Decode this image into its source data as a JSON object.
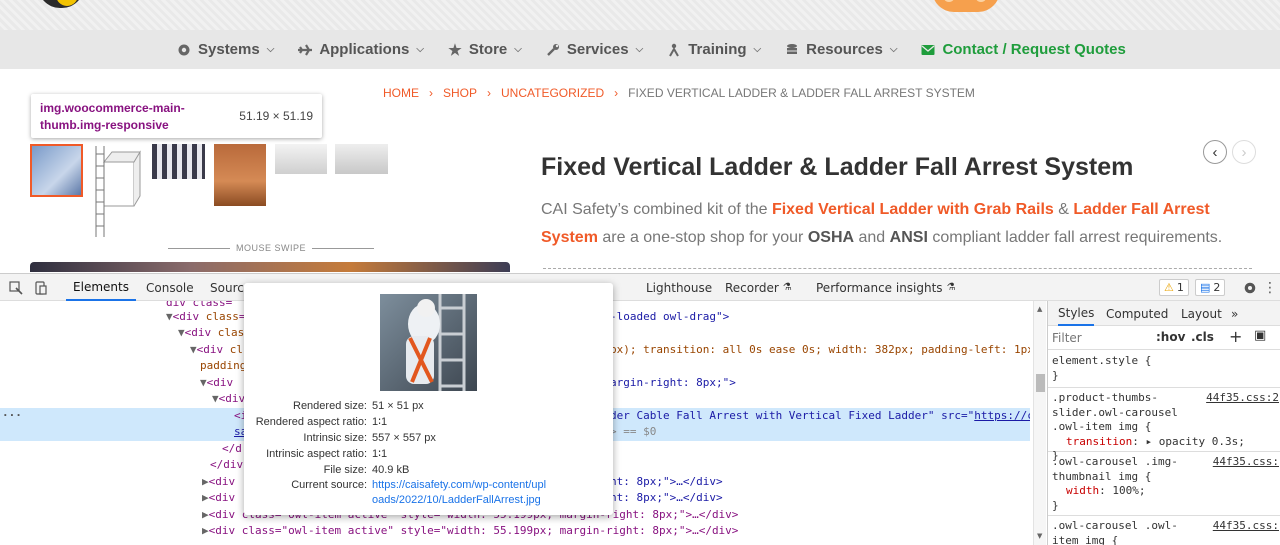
{
  "site": {
    "nav": [
      {
        "label": "Systems",
        "icon": "gear-icon"
      },
      {
        "label": "Applications",
        "icon": "plane-icon"
      },
      {
        "label": "Store",
        "icon": "star-icon"
      },
      {
        "label": "Services",
        "icon": "wrench-icon"
      },
      {
        "label": "Training",
        "icon": "person-icon"
      },
      {
        "label": "Resources",
        "icon": "database-icon"
      }
    ],
    "contact_label": "Contact / Request Quotes",
    "breadcrumb": [
      "HOME",
      "SHOP",
      "UNCATEGORIZED"
    ],
    "breadcrumb_current": "FIXED VERTICAL LADDER & LADDER FALL ARREST SYSTEM",
    "tooltip": {
      "selector": "img.woocommerce-main-thumb.img-responsive",
      "size": "51.19 × 51.19"
    },
    "swipe_label": "MOUSE SWIPE",
    "product": {
      "title": "Fixed Vertical Ladder & Ladder Fall Arrest System",
      "desc_1": "CAI Safety’s combined kit of the ",
      "desc_hl_1": "Fixed Vertical Ladder with Grab Rails",
      "desc_2": " & ",
      "desc_hl_2": "Ladder Fall Arrest System",
      "desc_3": " are a one-stop shop for your ",
      "desc_osha": "OSHA",
      "desc_4": " and ",
      "desc_ansi": "ANSI",
      "desc_5": " compliant ladder fall arrest requirements."
    },
    "colors": {
      "accent": "#f05a28",
      "contact": "#1f9d3c"
    }
  },
  "devtools": {
    "tabs": [
      "Elements",
      "Console",
      "Sources",
      "Lighthouse",
      "Recorder",
      "Performance insights"
    ],
    "warnings": "1",
    "messages": "2",
    "dom": {
      "l0": "div class=",
      "l1_tag": "div",
      "l1_attr": "class",
      "l2_tag": "div",
      "l2_attr": "clas",
      "l3_tag": "div",
      "l3_attr": "cl",
      "l3b": "padding",
      "l4_tag": "div",
      "l5_tag": "div",
      "right_1": "-loaded owl-drag\">",
      "right_2": "px); transition: all 0s ease 0s; width: 382px; padding-left: 1px;",
      "right_3": "argin-right: 8px;\">",
      "right_4a": "der Cable Fall Arrest with Vertical Fixed Ladder\" src=\"",
      "right_4b": "https://cai",
      "right_5": "> == $0",
      "sel_left": "sa",
      "close_1": "</d",
      "close_2": "</div",
      "row_a": "ht: 8px;\">…</div>",
      "row_b": "ht: 8px;\">…</div>",
      "row_c": "<div class=\"owl-item active\" style=\"width: 55.199px; margin-right: 8px;\">…</div>",
      "row_d": "<div class=\"owl-item active\" style=\"width: 55.199px; margin-right: 8px;\">…</div>",
      "left_a": "<div",
      "left_b": "<div"
    },
    "hover": {
      "rendered_size_label": "Rendered size:",
      "rendered_size": "51 × 51 px",
      "rendered_ratio_label": "Rendered aspect ratio:",
      "rendered_ratio": "1∶1",
      "intrinsic_size_label": "Intrinsic size:",
      "intrinsic_size": "557 × 557 px",
      "intrinsic_ratio_label": "Intrinsic aspect ratio:",
      "intrinsic_ratio": "1∶1",
      "file_size_label": "File size:",
      "file_size": "40.9 kB",
      "source_label": "Current source:",
      "source": "https://caisafety.com/wp-content/uploads/2022/10/LadderFallArrest.jpg"
    },
    "styles": {
      "tabs": [
        "Styles",
        "Computed",
        "Layout"
      ],
      "filter_placeholder": "Filter",
      "hov": ":hov",
      "cls": ".cls",
      "rules": [
        {
          "selector": "element.style {",
          "close": "}"
        },
        {
          "selector": ".product-thumbs-slider.owl-carousel .owl-item img {",
          "source": "44f35.css:2",
          "prop": "transition",
          "value": "▸ opacity 0.3s;",
          "close": "}"
        },
        {
          "selector": ".owl-carousel .img-thumbnail img {",
          "source": "44f35.css:",
          "prop": "width",
          "value": "100%;",
          "close": "}"
        },
        {
          "selector": ".owl-carousel .owl-item img {",
          "source": "44f35.css:"
        }
      ]
    }
  }
}
